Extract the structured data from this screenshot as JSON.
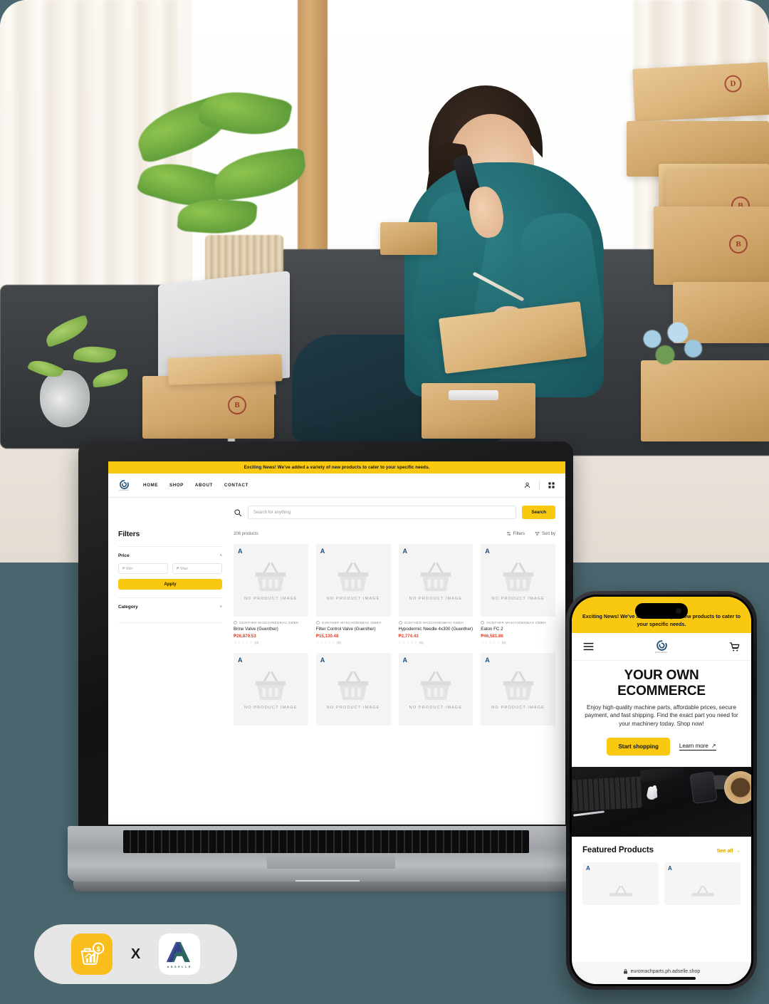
{
  "background_color": "#4a666f",
  "brand": {
    "accent_yellow": "#F9C912",
    "price_red": "#d8452f",
    "adselle_teal": "#2d5f5e",
    "adselle_navy": "#303a8c"
  },
  "hero_photo": {
    "alt": "woman-packing-parcels-photo",
    "description": "Woman in teal sweater sitting on floor talking on phone while writing on a cardboard parcel, surrounded by shipping boxes in a bright living room"
  },
  "laptop": {
    "device": "silver-laptop",
    "site": {
      "announcement": "Exciting News! We've added a variety of new products to cater to your specific needs.",
      "nav": {
        "logo_name": "euromachparts-logo",
        "links": [
          "HOME",
          "SHOP",
          "ABOUT",
          "CONTACT"
        ],
        "account_icon": "user-icon",
        "grid_icon": "grid-apps-icon"
      },
      "search": {
        "icon": "search-icon",
        "placeholder": "Search for anything",
        "value": "",
        "button_label": "Search"
      },
      "sidebar": {
        "title": "Filters",
        "sections": [
          {
            "label": "Price",
            "expanded": true,
            "chevron": "˄",
            "min_placeholder": "₱ Min",
            "max_placeholder": "₱ Max",
            "min_value": "",
            "max_value": "",
            "apply_label": "Apply"
          },
          {
            "label": "Category",
            "expanded": false,
            "chevron": "˅"
          }
        ]
      },
      "results": {
        "count_label": "208 products",
        "filters_label": "Filters",
        "sort_label": "Sort by",
        "no_image_label": "NO PRODUCT IMAGE",
        "brand_mark": "A",
        "products": [
          {
            "vendor": "GUNTHER MASCHINENBAU GMBH",
            "name": "Brine Valve (Guenther)",
            "price": "₱26,879.53",
            "rating": 0,
            "review_count": "(0)"
          },
          {
            "vendor": "GUNTHER MASCHINENBAU GMBH",
            "name": "Filter Control Valve (Guenther)",
            "price": "₱15,130.48",
            "rating": 0,
            "review_count": "(0)"
          },
          {
            "vendor": "GUNTHER MASCHINENBAU GMBH",
            "name": "Hypodermic Needle 4x300 (Guenther)",
            "price": "₱2,774.43",
            "rating": 0,
            "review_count": "(0)"
          },
          {
            "vendor": "GUNTHER MASCHINENBAU GMBH",
            "name": "Eaton FC 2",
            "price": "₱46,581.86",
            "rating": 0,
            "review_count": "(0)"
          }
        ],
        "second_row_cards": 4
      }
    }
  },
  "phone": {
    "device": "smartphone",
    "announcement": "Exciting News! We've added a variety of new products to cater to your specific needs.",
    "nav": {
      "menu_icon": "hamburger-menu-icon",
      "logo_name": "euromachparts-logo",
      "cart_icon": "shopping-cart-icon"
    },
    "hero": {
      "heading_line1": "YOUR OWN",
      "heading_line2": "ECOMMERCE",
      "subtext": "Enjoy high-quality machine parts, affordable prices, secure payment, and fast shipping. Find the exact part you need for your machinery today. Shop now!",
      "primary_button": "Start shopping",
      "secondary_link": "Learn more",
      "secondary_link_icon": "↗"
    },
    "desk_image_alt": "dark-desk-flatlay-photo",
    "featured": {
      "title": "Featured Products",
      "see_all": "See all",
      "see_all_icon": "→",
      "cards": [
        {
          "brand_mark": "A"
        },
        {
          "brand_mark": "A"
        }
      ]
    },
    "url_bar": {
      "lock_icon": "lock-icon",
      "url": "euromachparts.ph.adselle.shop"
    }
  },
  "logo_pill": {
    "left_logo_name": "ecommerce-basket-chart-logo",
    "separator": "X",
    "right_logo_name": "adselle-logo",
    "right_logo_letter": "A",
    "right_logo_word": "ADSELLE"
  }
}
